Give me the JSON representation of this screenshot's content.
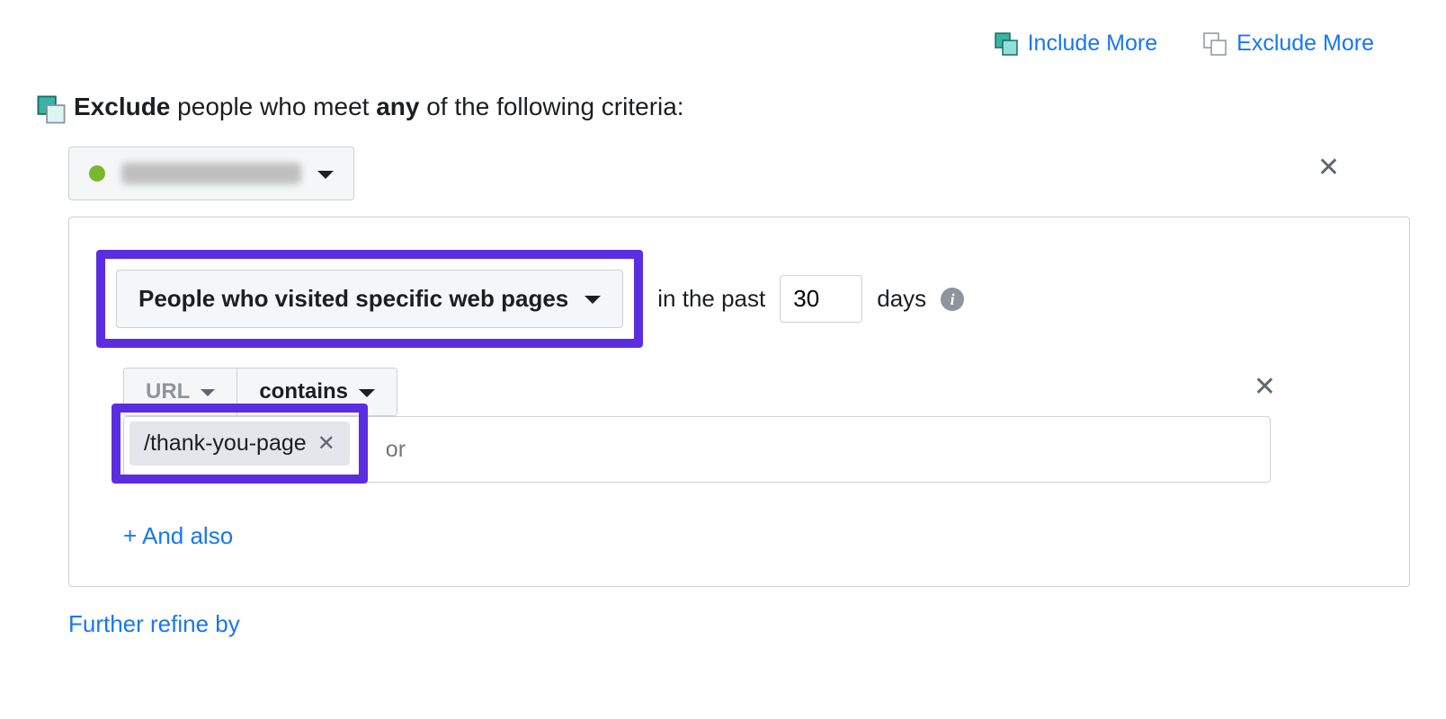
{
  "top": {
    "include_more": "Include More",
    "exclude_more": "Exclude More"
  },
  "exclude_heading": {
    "exclude": "Exclude",
    "people_who_meet": " people who meet ",
    "any": "any",
    "rest": " of the following criteria:"
  },
  "criteria": {
    "rule_type": "People who visited specific web pages",
    "in_past": "in the past",
    "days_value": "30",
    "days_label": "days",
    "url_label": "URL",
    "contains_label": "contains",
    "chip_value": "/thank-you-page",
    "or_placeholder": "or",
    "and_also": "+ And also"
  },
  "further_refine": "Further refine by"
}
